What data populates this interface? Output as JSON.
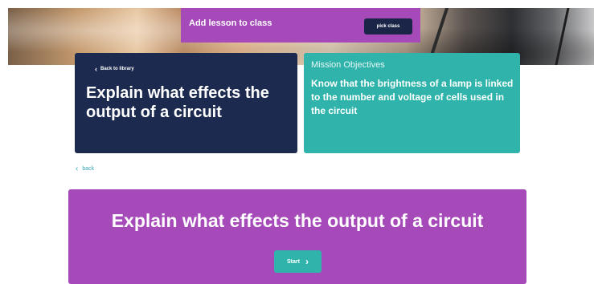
{
  "banner": {
    "add_lesson_label": "Add lesson to class",
    "pick_class_label": "pick class"
  },
  "title_card": {
    "back_label": "Back to library",
    "back_icon": "chevron-left-icon",
    "title": "Explain what effects the output of a circuit"
  },
  "objectives": {
    "heading": "Mission Objectives",
    "text": "Know that the brightness of a lamp is linked to the number and voltage of cells used in the circuit"
  },
  "back_link": {
    "label": "back",
    "icon": "chevron-left-icon"
  },
  "lesson": {
    "title": "Explain what effects the output of a circuit",
    "start_label": "Start",
    "start_icon": "chevron-right-icon"
  },
  "colors": {
    "purple": "#a64aba",
    "navy": "#1b2a4e",
    "teal": "#2fb3ab"
  }
}
